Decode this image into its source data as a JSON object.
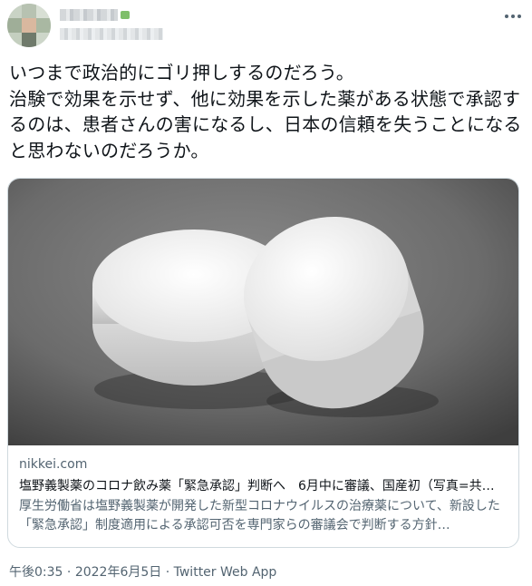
{
  "tweet": {
    "text": "いつまで政治的にゴリ押しするのだろう。\n治験で効果を示せず、他に効果を示した薬がある状態で承認するのは、患者さんの害になるし、日本の信頼を失うことになると思わないのだろうか。"
  },
  "card": {
    "domain": "nikkei.com",
    "title": "塩野義製薬のコロナ飲み薬「緊急承認」判断へ　6月中に審議、国産初（写真=共…",
    "description": "厚生労働省は塩野義製薬が開発した新型コロナウイルスの治療薬について、新設した「緊急承認」制度適用による承認可否を専門家らの審議会で判断する方針…"
  },
  "meta": {
    "time": "午後0:35",
    "separator1": " · ",
    "date": "2022年6月5日",
    "separator2": " · ",
    "source": "Twitter Web App"
  },
  "icons": {
    "more": "more-horizontal-icon",
    "verified": "verified-badge-icon"
  }
}
